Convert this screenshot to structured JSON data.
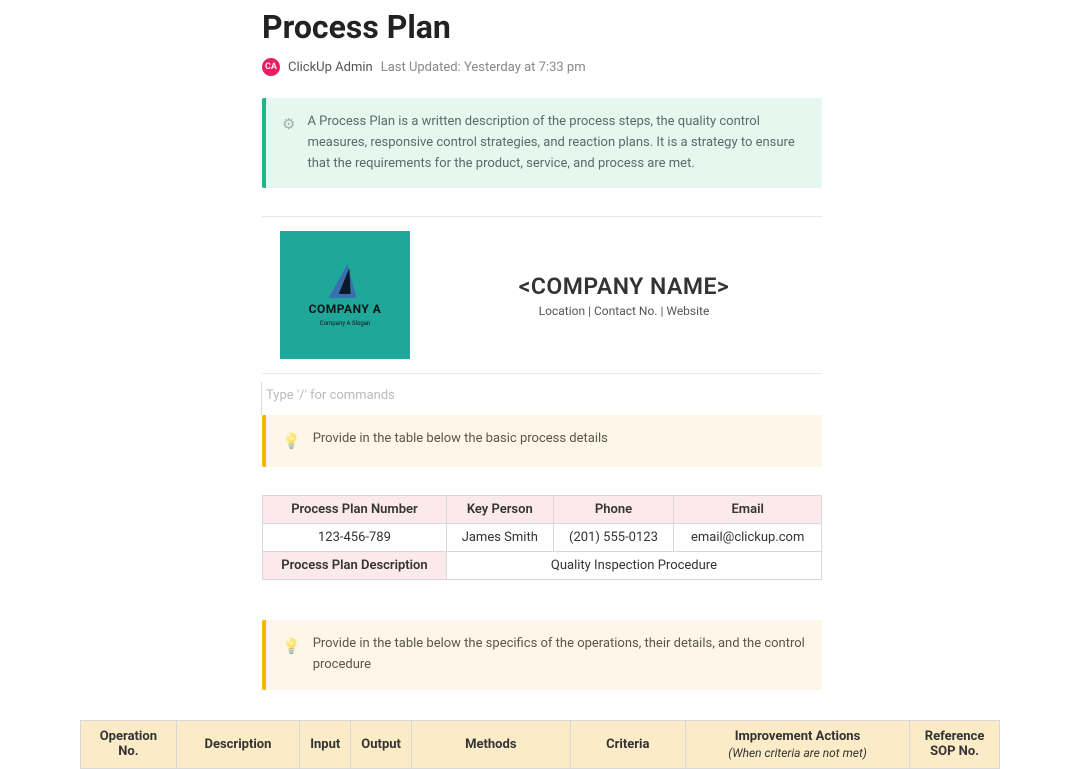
{
  "page": {
    "title": "Process Plan",
    "author_initials": "CA",
    "author_name": "ClickUp Admin",
    "last_updated_label": "Last Updated:",
    "last_updated_value": "Yesterday at 7:33 pm"
  },
  "callout_info": {
    "icon": "⚙",
    "text": "A Process Plan is a written description of the process steps, the quality control measures, responsive control strategies, and reaction plans. It is a strategy to ensure that the requirements for the product, service, and process are met."
  },
  "company": {
    "logo_name": "COMPANY A",
    "logo_slogan": "Company A Slogan",
    "name_placeholder": "<COMPANY NAME>",
    "subline": "Location | Contact No. | Website"
  },
  "slash_prompt": "Type '/' for commands",
  "callout_tip1": {
    "icon": "💡",
    "text": "Provide in the table below the basic process details"
  },
  "details_table": {
    "headers": {
      "plan_number": "Process Plan Number",
      "key_person": "Key Person",
      "phone": "Phone",
      "email": "Email"
    },
    "row": {
      "plan_number": "123-456-789",
      "key_person": "James Smith",
      "phone": "(201) 555-0123",
      "email": "email@clickup.com"
    },
    "desc_label": "Process Plan Description",
    "desc_value": "Quality Inspection Procedure"
  },
  "callout_tip2": {
    "icon": "💡",
    "text": "Provide in the table below the specifics of the operations, their details, and the control procedure"
  },
  "ops_table": {
    "headers": {
      "op_no": "Operation No.",
      "description": "Description",
      "input": "Input",
      "output": "Output",
      "methods": "Methods",
      "criteria": "Criteria",
      "improvement": "Improvement Actions",
      "improvement_sub": "(When criteria are not met)",
      "reference": "Reference SOP No."
    }
  }
}
